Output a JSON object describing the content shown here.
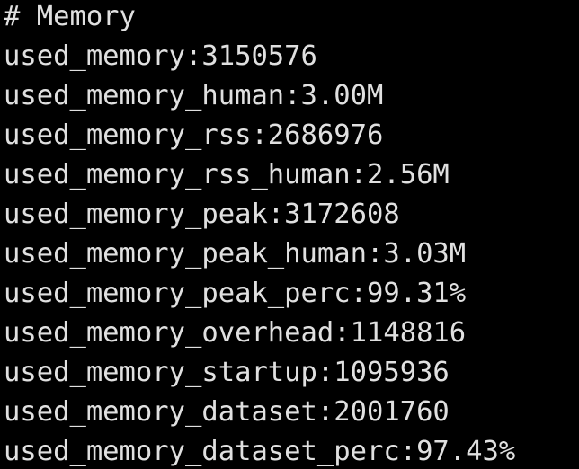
{
  "terminal": {
    "colors": {
      "background": "#000000",
      "text": "#e0e0e0"
    },
    "lines": [
      "# Memory",
      "used_memory:3150576",
      "used_memory_human:3.00M",
      "used_memory_rss:2686976",
      "used_memory_rss_human:2.56M",
      "used_memory_peak:3172608",
      "used_memory_peak_human:3.03M",
      "used_memory_peak_perc:99.31%",
      "used_memory_overhead:1148816",
      "used_memory_startup:1095936",
      "used_memory_dataset:2001760",
      "used_memory_dataset_perc:97.43%"
    ]
  }
}
